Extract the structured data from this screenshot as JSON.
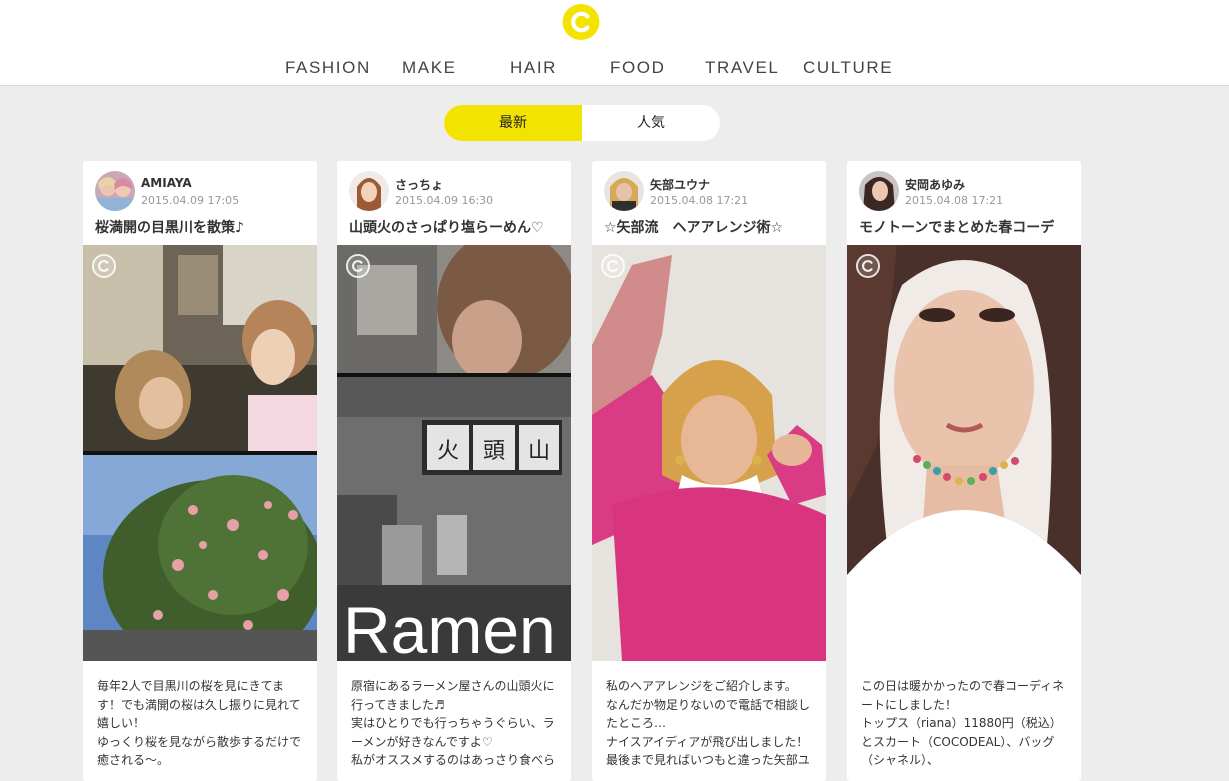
{
  "header": {
    "logo_icon": "c-logo-icon",
    "nav": [
      "FASHION",
      "MAKE",
      "HAIR",
      "FOOD",
      "TRAVEL",
      "CULTURE"
    ]
  },
  "toggle": {
    "active_label": "最新",
    "inactive_label": "人気"
  },
  "colors": {
    "brand_yellow": "#f3e300",
    "background": "#ededed"
  },
  "cards": [
    {
      "username": "AMIAYA",
      "date": "2015.04.09 17:05",
      "title": "桜満開の目黒川を散策♪",
      "description": "毎年2人で目黒川の桜を見にきてます！でも満開の桜は久し振りに見れて嬉しい！\nゆっくり桜を見ながら散歩するだけで癒される〜。"
    },
    {
      "username": "さっちょ",
      "date": "2015.04.09 16:30",
      "title": "山頭火のさっぱり塩らーめん♡",
      "overlay_text": "Ramen",
      "description": "原宿にあるラーメン屋さんの山頭火に行ってきました♬\n実はひとりでも行っちゃうぐらい、ラーメンが好きなんですよ♡\n私がオススメするのはあっさり食べら"
    },
    {
      "username": "矢部ユウナ",
      "date": "2015.04.08 17:21",
      "title": "☆矢部流　ヘアアレンジ術☆",
      "description": "私のヘアアレンジをご紹介します。\nなんだか物足りないので電話で相談したところ…\nナイスアイディアが飛び出しました！\n最後まで見ればいつもと違った矢部ユ"
    },
    {
      "username": "安岡あゆみ",
      "date": "2015.04.08 17:21",
      "title": "モノトーンでまとめた春コーデ",
      "description": "この日は暖かかったので春コーディネートにしました！\nトップス（riana）11880円（税込）とスカート（COCODEAL）、バッグ（シャネル）、"
    }
  ]
}
